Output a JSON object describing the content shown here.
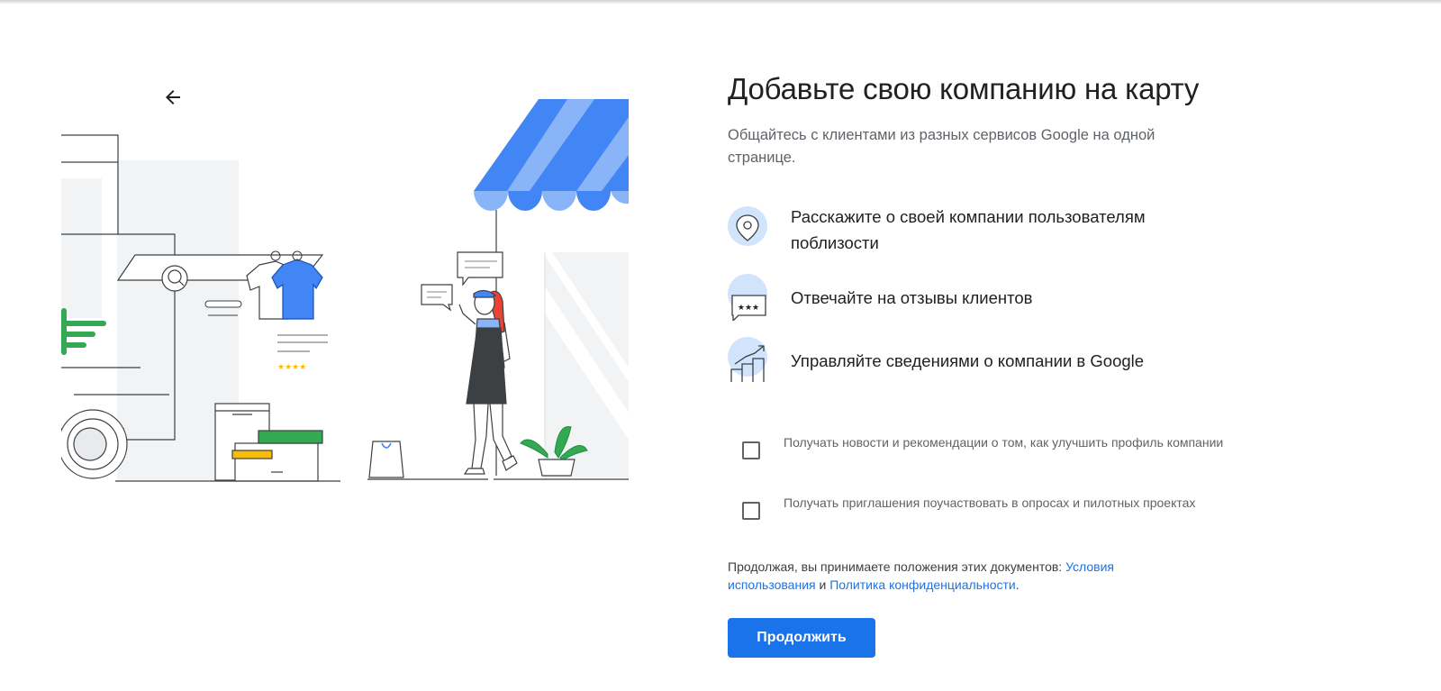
{
  "header": {
    "back_icon": "arrow-back-icon"
  },
  "main": {
    "title": "Добавьте свою компанию на карту",
    "subtitle": "Общайтесь с клиентами из разных сервисов Google на одной странице.",
    "features": [
      {
        "icon": "location-pin-icon",
        "text": "Расскажите о своей компании пользователям поблизости"
      },
      {
        "icon": "review-stars-icon",
        "text": "Отвечайте на отзывы клиентов"
      },
      {
        "icon": "growth-chart-icon",
        "text": "Управляйте сведениями о компании в Google"
      }
    ],
    "checkboxes": [
      {
        "label": "Получать новости и рекомендации о том, как улучшить профиль компании",
        "checked": false
      },
      {
        "label": "Получать приглашения поучаствовать в опросах и пилотных проектах",
        "checked": false
      }
    ],
    "terms": {
      "prefix": "Продолжая, вы принимаете положения этих документов: ",
      "link1": "Условия использования",
      "middle": " и ",
      "link2": "Политика конфиденциальности",
      "suffix": "."
    },
    "continue_label": "Продолжить"
  },
  "illustration": {
    "rating_stars": "★★★★",
    "review_stars": "★★★"
  },
  "colors": {
    "primary": "#1a73e8",
    "awning_dark": "#4285f4",
    "awning_light": "#8ab4f8",
    "green": "#34a853",
    "yellow": "#fbbc04",
    "red": "#ea4335",
    "icon_bg": "#d2e3fc"
  }
}
